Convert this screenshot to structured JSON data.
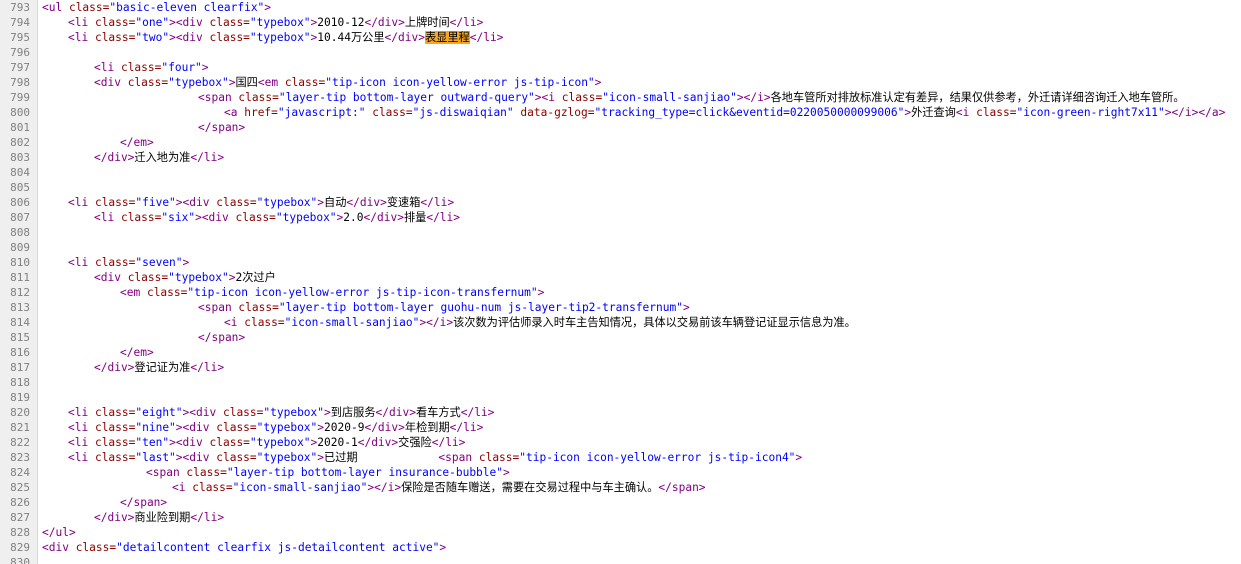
{
  "colors": {
    "tag": "#800080",
    "attribute": "#8b0000",
    "value": "#0000ff",
    "text": "#000000",
    "line_number": "#808080",
    "highlight": "#f5a623"
  },
  "lines": [
    {
      "n": "793",
      "indent": 0,
      "tokens": [
        [
          "t",
          "<ul "
        ],
        [
          "a",
          "class="
        ],
        [
          "v",
          "\"basic-eleven clearfix\""
        ],
        [
          "t",
          ">"
        ]
      ]
    },
    {
      "n": "794",
      "indent": 1,
      "tokens": [
        [
          "t",
          "<li "
        ],
        [
          "a",
          "class="
        ],
        [
          "v",
          "\"one\""
        ],
        [
          "t",
          ">"
        ],
        [
          "t",
          "<div "
        ],
        [
          "a",
          "class="
        ],
        [
          "v",
          "\"typebox\""
        ],
        [
          "t",
          ">"
        ],
        [
          "x",
          "2010-12"
        ],
        [
          "t",
          "</div>"
        ],
        [
          "x",
          "上牌时间"
        ],
        [
          "t",
          "</li>"
        ]
      ]
    },
    {
      "n": "795",
      "indent": 1,
      "tokens": [
        [
          "t",
          "<li "
        ],
        [
          "a",
          "class="
        ],
        [
          "v",
          "\"two\""
        ],
        [
          "t",
          ">"
        ],
        [
          "t",
          "<div "
        ],
        [
          "a",
          "class="
        ],
        [
          "v",
          "\"typebox\""
        ],
        [
          "t",
          ">"
        ],
        [
          "x",
          "10.44万公里"
        ],
        [
          "t",
          "</div>"
        ],
        [
          "h",
          "表显里程"
        ],
        [
          "t",
          "</li>"
        ]
      ]
    },
    {
      "n": "796",
      "indent": 0,
      "tokens": []
    },
    {
      "n": "797",
      "indent": 2,
      "tokens": [
        [
          "t",
          "<li "
        ],
        [
          "a",
          "class="
        ],
        [
          "v",
          "\"four\""
        ],
        [
          "t",
          ">"
        ]
      ]
    },
    {
      "n": "798",
      "indent": 2,
      "tokens": [
        [
          "t",
          "<div "
        ],
        [
          "a",
          "class="
        ],
        [
          "v",
          "\"typebox\""
        ],
        [
          "t",
          ">"
        ],
        [
          "x",
          "国四"
        ],
        [
          "t",
          "<em "
        ],
        [
          "a",
          "class="
        ],
        [
          "v",
          "\"tip-icon icon-yellow-error js-tip-icon\""
        ],
        [
          "t",
          ">"
        ]
      ]
    },
    {
      "n": "799",
      "indent": 6,
      "tokens": [
        [
          "t",
          "<span "
        ],
        [
          "a",
          "class="
        ],
        [
          "v",
          "\"layer-tip bottom-layer outward-query\""
        ],
        [
          "t",
          ">"
        ],
        [
          "t",
          "<i "
        ],
        [
          "a",
          "class="
        ],
        [
          "v",
          "\"icon-small-sanjiao\""
        ],
        [
          "t",
          ">"
        ],
        [
          "t",
          "</i>"
        ],
        [
          "x",
          "各地车管所对排放标准认定有差异，结果仅供参考，外迁请详细咨询迁入地车管所。"
        ]
      ]
    },
    {
      "n": "800",
      "indent": 7,
      "tokens": [
        [
          "t",
          "<a "
        ],
        [
          "a",
          "href="
        ],
        [
          "v",
          "\"javascript:\""
        ],
        [
          "a",
          " class="
        ],
        [
          "v",
          "\"js-diswaiqian\""
        ],
        [
          "a",
          " data-gzlog="
        ],
        [
          "v",
          "\"tracking_type=click&eventid=0220050000099006\""
        ],
        [
          "t",
          ">"
        ],
        [
          "x",
          "外迁查询"
        ],
        [
          "t",
          "<i "
        ],
        [
          "a",
          "class="
        ],
        [
          "v",
          "\"icon-green-right7x11\""
        ],
        [
          "t",
          ">"
        ],
        [
          "t",
          "</i>"
        ],
        [
          "t",
          "</a>"
        ]
      ]
    },
    {
      "n": "801",
      "indent": 6,
      "tokens": [
        [
          "t",
          "</span>"
        ]
      ]
    },
    {
      "n": "802",
      "indent": 3,
      "tokens": [
        [
          "t",
          "</em>"
        ]
      ]
    },
    {
      "n": "803",
      "indent": 2,
      "tokens": [
        [
          "t",
          "</div>"
        ],
        [
          "x",
          "迁入地为准"
        ],
        [
          "t",
          "</li>"
        ]
      ]
    },
    {
      "n": "804",
      "indent": 0,
      "tokens": []
    },
    {
      "n": "805",
      "indent": 0,
      "tokens": []
    },
    {
      "n": "806",
      "indent": 1,
      "tokens": [
        [
          "t",
          "<li "
        ],
        [
          "a",
          "class="
        ],
        [
          "v",
          "\"five\""
        ],
        [
          "t",
          ">"
        ],
        [
          "t",
          "<div "
        ],
        [
          "a",
          "class="
        ],
        [
          "v",
          "\"typebox\""
        ],
        [
          "t",
          ">"
        ],
        [
          "x",
          "自动"
        ],
        [
          "t",
          "</div>"
        ],
        [
          "x",
          "变速箱"
        ],
        [
          "t",
          "</li>"
        ]
      ]
    },
    {
      "n": "807",
      "indent": 2,
      "tokens": [
        [
          "t",
          "<li "
        ],
        [
          "a",
          "class="
        ],
        [
          "v",
          "\"six\""
        ],
        [
          "t",
          ">"
        ],
        [
          "t",
          "<div "
        ],
        [
          "a",
          "class="
        ],
        [
          "v",
          "\"typebox\""
        ],
        [
          "t",
          ">"
        ],
        [
          "x",
          "2.0"
        ],
        [
          "t",
          "</div>"
        ],
        [
          "x",
          "排量"
        ],
        [
          "t",
          "</li>"
        ]
      ]
    },
    {
      "n": "808",
      "indent": 0,
      "tokens": []
    },
    {
      "n": "809",
      "indent": 0,
      "tokens": []
    },
    {
      "n": "810",
      "indent": 1,
      "tokens": [
        [
          "t",
          "<li "
        ],
        [
          "a",
          "class="
        ],
        [
          "v",
          "\"seven\""
        ],
        [
          "t",
          ">"
        ]
      ]
    },
    {
      "n": "811",
      "indent": 2,
      "tokens": [
        [
          "t",
          "<div "
        ],
        [
          "a",
          "class="
        ],
        [
          "v",
          "\"typebox\""
        ],
        [
          "t",
          ">"
        ],
        [
          "x",
          "2次过户"
        ]
      ]
    },
    {
      "n": "812",
      "indent": 3,
      "tokens": [
        [
          "t",
          "<em "
        ],
        [
          "a",
          "class="
        ],
        [
          "v",
          "\"tip-icon icon-yellow-error js-tip-icon-transfernum\""
        ],
        [
          "t",
          ">"
        ]
      ]
    },
    {
      "n": "813",
      "indent": 6,
      "tokens": [
        [
          "t",
          "<span "
        ],
        [
          "a",
          "class="
        ],
        [
          "v",
          "\"layer-tip bottom-layer guohu-num js-layer-tip2-transfernum\""
        ],
        [
          "t",
          ">"
        ]
      ]
    },
    {
      "n": "814",
      "indent": 7,
      "tokens": [
        [
          "t",
          "<i "
        ],
        [
          "a",
          "class="
        ],
        [
          "v",
          "\"icon-small-sanjiao\""
        ],
        [
          "t",
          ">"
        ],
        [
          "t",
          "</i>"
        ],
        [
          "x",
          "该次数为评估师录入时车主告知情况，具体以交易前该车辆登记证显示信息为准。"
        ]
      ]
    },
    {
      "n": "815",
      "indent": 6,
      "tokens": [
        [
          "t",
          "</span>"
        ]
      ]
    },
    {
      "n": "816",
      "indent": 3,
      "tokens": [
        [
          "t",
          "</em>"
        ]
      ]
    },
    {
      "n": "817",
      "indent": 2,
      "tokens": [
        [
          "t",
          "</div>"
        ],
        [
          "x",
          "登记证为准"
        ],
        [
          "t",
          "</li>"
        ]
      ]
    },
    {
      "n": "818",
      "indent": 0,
      "tokens": []
    },
    {
      "n": "819",
      "indent": 0,
      "tokens": []
    },
    {
      "n": "820",
      "indent": 1,
      "tokens": [
        [
          "t",
          "<li "
        ],
        [
          "a",
          "class="
        ],
        [
          "v",
          "\"eight\""
        ],
        [
          "t",
          ">"
        ],
        [
          "t",
          "<div "
        ],
        [
          "a",
          "class="
        ],
        [
          "v",
          "\"typebox\""
        ],
        [
          "t",
          ">"
        ],
        [
          "x",
          "到店服务"
        ],
        [
          "t",
          "</div>"
        ],
        [
          "x",
          "看车方式"
        ],
        [
          "t",
          "</li>"
        ]
      ]
    },
    {
      "n": "821",
      "indent": 1,
      "tokens": [
        [
          "t",
          "<li "
        ],
        [
          "a",
          "class="
        ],
        [
          "v",
          "\"nine\""
        ],
        [
          "t",
          ">"
        ],
        [
          "t",
          "<div "
        ],
        [
          "a",
          "class="
        ],
        [
          "v",
          "\"typebox\""
        ],
        [
          "t",
          ">"
        ],
        [
          "x",
          "2020-9"
        ],
        [
          "t",
          "</div>"
        ],
        [
          "x",
          "年检到期"
        ],
        [
          "t",
          "</li>"
        ]
      ]
    },
    {
      "n": "822",
      "indent": 1,
      "tokens": [
        [
          "t",
          "<li "
        ],
        [
          "a",
          "class="
        ],
        [
          "v",
          "\"ten\""
        ],
        [
          "t",
          ">"
        ],
        [
          "t",
          "<div "
        ],
        [
          "a",
          "class="
        ],
        [
          "v",
          "\"typebox\""
        ],
        [
          "t",
          ">"
        ],
        [
          "x",
          "2020-1"
        ],
        [
          "t",
          "</div>"
        ],
        [
          "x",
          "交强险"
        ],
        [
          "t",
          "</li>"
        ]
      ]
    },
    {
      "n": "823",
      "indent": 1,
      "tokens": [
        [
          "t",
          "<li "
        ],
        [
          "a",
          "class="
        ],
        [
          "v",
          "\"last\""
        ],
        [
          "t",
          ">"
        ],
        [
          "t",
          "<div "
        ],
        [
          "a",
          "class="
        ],
        [
          "v",
          "\"typebox\""
        ],
        [
          "t",
          ">"
        ],
        [
          "x",
          "已过期            "
        ],
        [
          "t",
          "<span "
        ],
        [
          "a",
          "class="
        ],
        [
          "v",
          "\"tip-icon icon-yellow-error js-tip-icon4\""
        ],
        [
          "t",
          ">"
        ]
      ]
    },
    {
      "n": "824",
      "indent": 4,
      "tokens": [
        [
          "t",
          "<span "
        ],
        [
          "a",
          "class="
        ],
        [
          "v",
          "\"layer-tip bottom-layer insurance-bubble\""
        ],
        [
          "t",
          ">"
        ]
      ]
    },
    {
      "n": "825",
      "indent": 5,
      "tokens": [
        [
          "t",
          "<i "
        ],
        [
          "a",
          "class="
        ],
        [
          "v",
          "\"icon-small-sanjiao\""
        ],
        [
          "t",
          ">"
        ],
        [
          "t",
          "</i>"
        ],
        [
          "x",
          "保险是否随车赠送，需要在交易过程中与车主确认。"
        ],
        [
          "t",
          "</span>"
        ]
      ]
    },
    {
      "n": "826",
      "indent": 3,
      "tokens": [
        [
          "t",
          "</span>"
        ]
      ]
    },
    {
      "n": "827",
      "indent": 2,
      "tokens": [
        [
          "t",
          "</div>"
        ],
        [
          "x",
          "商业险到期"
        ],
        [
          "t",
          "</li>"
        ]
      ]
    },
    {
      "n": "828",
      "indent": 0,
      "tokens": [
        [
          "t",
          "</ul>"
        ]
      ]
    },
    {
      "n": "829",
      "indent": 0,
      "tokens": [
        [
          "t",
          "<div "
        ],
        [
          "a",
          "class="
        ],
        [
          "v",
          "\"detailcontent clearfix js-detailcontent active\""
        ],
        [
          "t",
          ">"
        ]
      ]
    },
    {
      "n": "830",
      "indent": 0,
      "tokens": []
    }
  ]
}
